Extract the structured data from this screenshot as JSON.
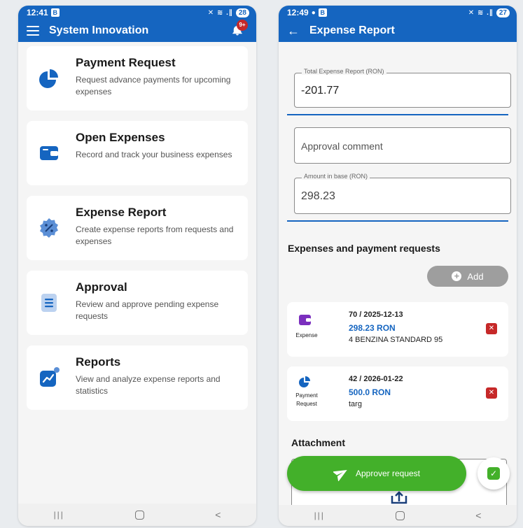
{
  "left": {
    "status": {
      "time": "12:41",
      "badge": "B",
      "signal": "✕ ≋ .∥",
      "battery": "28"
    },
    "appbar": {
      "title": "System Innovation",
      "notif_count": "9+"
    },
    "menu": [
      {
        "title": "Payment Request",
        "desc": "Request advance payments for upcoming expenses",
        "icon": "pie-chart-icon"
      },
      {
        "title": "Open Expenses",
        "desc": "Record and track your business expenses",
        "icon": "wallet-icon"
      },
      {
        "title": "Expense Report",
        "desc": "Create expense reports from requests and expenses",
        "icon": "percent-badge-icon"
      },
      {
        "title": "Approval",
        "desc": "Review and approve pending expense requests",
        "icon": "document-icon"
      },
      {
        "title": "Reports",
        "desc": "View and analyze expense reports and statistics",
        "icon": "trend-chart-icon"
      }
    ]
  },
  "right": {
    "status": {
      "time": "12:49",
      "badge": "B",
      "signal": "✕ ≋ .∥",
      "battery": "27"
    },
    "appbar": {
      "title": "Expense Report"
    },
    "total_field": {
      "label": "Total Expense Report (RON)",
      "value": "-201.77"
    },
    "approval_comment": {
      "placeholder": "Approval comment"
    },
    "base_field": {
      "label": "Amount in base (RON)",
      "value": "298.23"
    },
    "section_title": "Expenses and payment requests",
    "add_label": "Add",
    "items": [
      {
        "type": "Expense",
        "ref": "70 / 2025-12-13",
        "amount": "298.23 RON",
        "desc": "4 BENZINA STANDARD 95"
      },
      {
        "type": "Payment Request",
        "ref": "42 / 2026-01-22",
        "amount": "500.0 RON",
        "desc": "targ"
      }
    ],
    "attachment_title": "Attachment",
    "approver_label": "Approver request"
  },
  "colors": {
    "primary": "#1565c0",
    "green": "#43b02a",
    "danger": "#c62828"
  }
}
